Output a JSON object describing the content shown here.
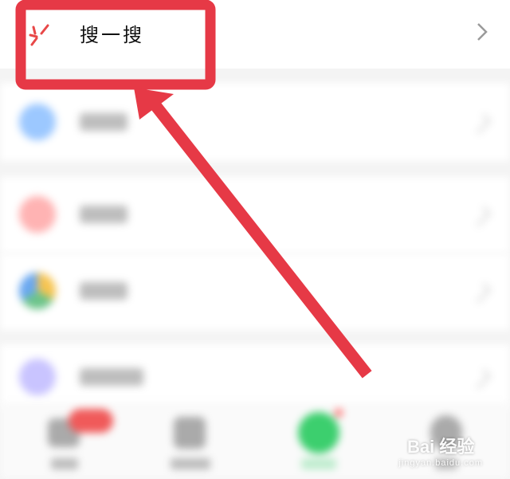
{
  "search_row": {
    "label": "搜一搜"
  },
  "watermark": {
    "brand": "Bai  经验",
    "url": "jingyan.baidu.com"
  },
  "colors": {
    "highlight": "#e63946",
    "icon_red": "#e84848"
  }
}
